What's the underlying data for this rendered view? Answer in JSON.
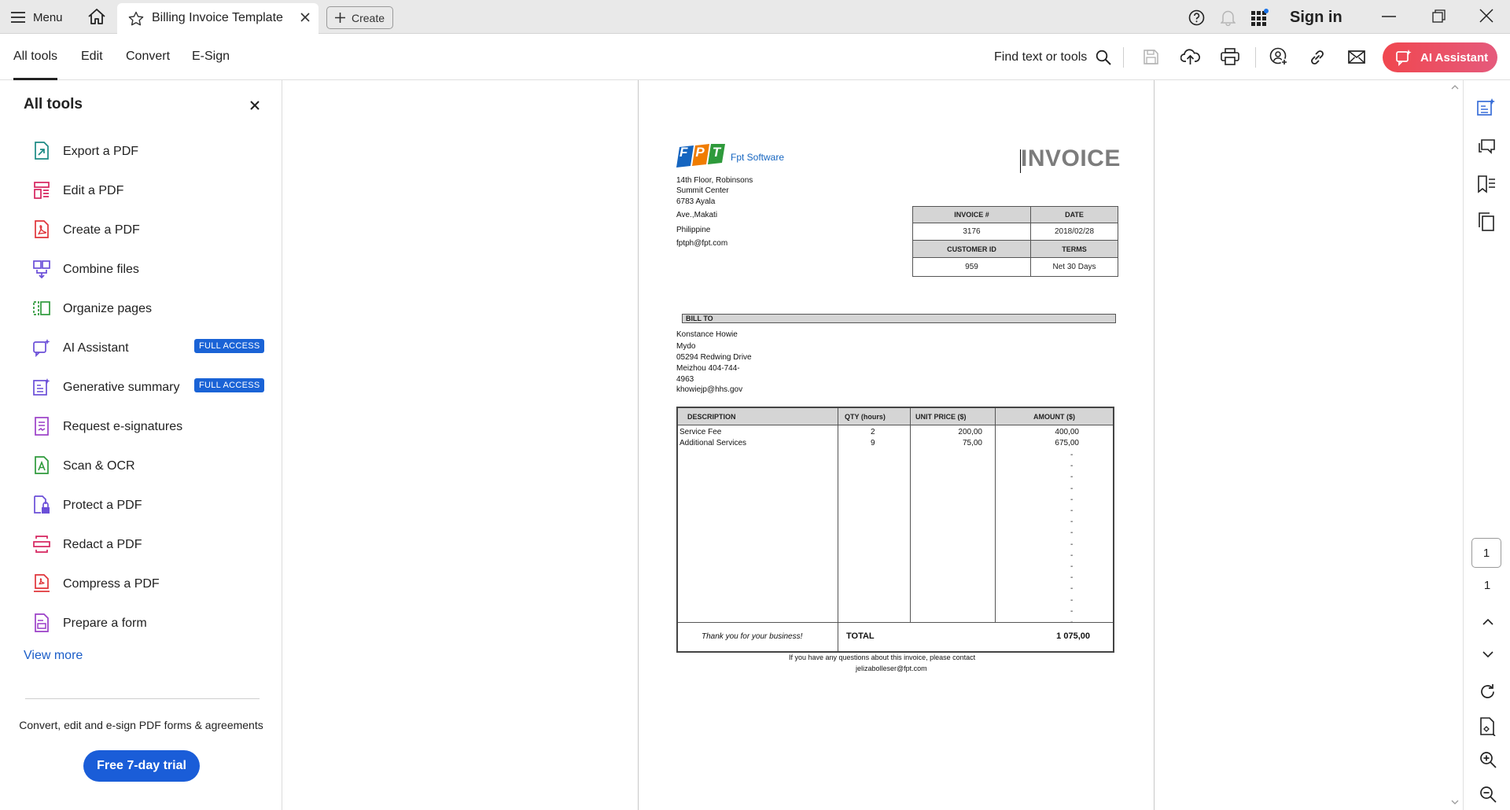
{
  "titlebar": {
    "menu_label": "Menu",
    "tab_title": "Billing Invoice Template",
    "create_label": "Create",
    "sign_in": "Sign in"
  },
  "toolbar": {
    "tabs": [
      "All tools",
      "Edit",
      "Convert",
      "E-Sign"
    ],
    "find_label": "Find text or tools",
    "ai_assistant_label": "AI Assistant"
  },
  "left_panel": {
    "title": "All tools",
    "items": [
      {
        "label": "Export a PDF",
        "icon": "export-pdf-icon",
        "color": "#1b8a84"
      },
      {
        "label": "Edit a PDF",
        "icon": "edit-pdf-icon",
        "color": "#d6245f"
      },
      {
        "label": "Create a PDF",
        "icon": "create-pdf-icon",
        "color": "#e0343a"
      },
      {
        "label": "Combine files",
        "icon": "combine-files-icon",
        "color": "#6b4fd8"
      },
      {
        "label": "Organize pages",
        "icon": "organize-pages-icon",
        "color": "#2e9a3b"
      },
      {
        "label": "AI Assistant",
        "icon": "ai-assistant-icon",
        "color": "#6b4fd8",
        "badge": "FULL ACCESS"
      },
      {
        "label": "Generative summary",
        "icon": "generative-summary-icon",
        "color": "#6b4fd8",
        "badge": "FULL ACCESS"
      },
      {
        "label": "Request e-signatures",
        "icon": "request-esignatures-icon",
        "color": "#9b3fc8"
      },
      {
        "label": "Scan & OCR",
        "icon": "scan-ocr-icon",
        "color": "#2e9a3b"
      },
      {
        "label": "Protect a PDF",
        "icon": "protect-pdf-icon",
        "color": "#6b4fd8"
      },
      {
        "label": "Redact a PDF",
        "icon": "redact-pdf-icon",
        "color": "#d6245f"
      },
      {
        "label": "Compress a PDF",
        "icon": "compress-pdf-icon",
        "color": "#e0343a"
      },
      {
        "label": "Prepare a form",
        "icon": "prepare-form-icon",
        "color": "#9b3fc8"
      }
    ],
    "view_more": "View more",
    "promo_text": "Convert, edit and e-sign PDF forms & agreements",
    "trial_button": "Free 7-day trial"
  },
  "invoice": {
    "company_name": "Fpt Software",
    "logo_letters": "FPT",
    "address_lines": [
      "14th Floor, Robinsons",
      "Summit Center",
      "6783 Ayala",
      "Ave.,Makati",
      "Philippine",
      "fptph@fpt.com"
    ],
    "title": "INVOICE",
    "meta_headers": [
      "INVOICE #",
      "DATE",
      "CUSTOMER ID",
      "TERMS"
    ],
    "invoice_number": "3176",
    "date": "2018/02/28",
    "customer_id": "959",
    "terms": "Net 30 Days",
    "bill_to_label": "BILL TO",
    "bill_to_lines": [
      "Konstance Howie",
      "Mydo",
      "05294 Redwing Drive",
      "Meizhou 404-744-",
      "4963",
      "khowiejp@hhs.gov"
    ],
    "table_headers": [
      "DESCRIPTION",
      "QTY (hours)",
      "UNIT PRICE ($)",
      "AMOUNT ($)"
    ],
    "rows": [
      {
        "description": "Service Fee",
        "qty": "2",
        "unit_price": "200,00",
        "amount": "400,00"
      },
      {
        "description": "Additional Services",
        "qty": "9",
        "unit_price": "75,00",
        "amount": "675,00"
      }
    ],
    "empty_amount_mark": "-",
    "thank_you": "Thank you for your business!",
    "total_label": "TOTAL",
    "total_value": "1 075,00",
    "footer_line1": "If you have any questions about this invoice, please contact",
    "footer_line2": "jelizabolleser@fpt.com"
  },
  "right_rail": {
    "current_page": "1",
    "total_pages": "1"
  },
  "colors": {
    "accent_blue": "#1a5dd8",
    "ai_gradient_start": "#f0474f",
    "ai_gradient_end": "#e55a7c",
    "badge_blue": "#1a63d6",
    "table_header_gray": "#d5d5d5"
  }
}
